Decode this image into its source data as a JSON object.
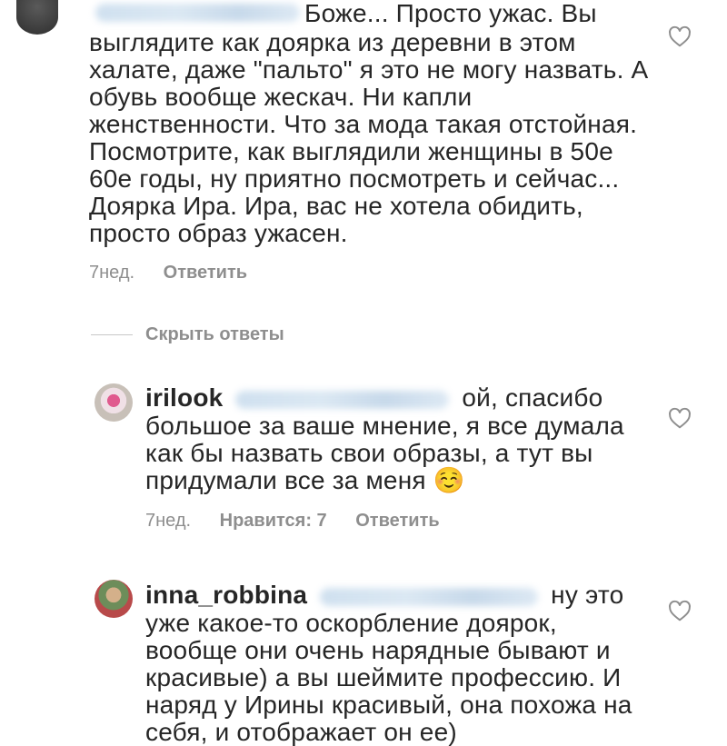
{
  "comment1": {
    "first_line": "Боже... Просто ужас. Вы",
    "lines": [
      "выглядите как доярка из деревни в этом",
      "халате, даже \"пальто\" я это не могу назвать. А",
      "обувь вообще жескач. Ни капли",
      "женственности. Что за мода такая отстойная.",
      "Посмотрите, как выглядили женщины в 50е",
      "60е годы, ну приятно посмотреть и сейчас...",
      "Доярка Ира. Ира, вас не хотела обидить,",
      "просто образ ужасен."
    ],
    "time": "7нед.",
    "reply_label": "Ответить",
    "like_icon": "heart-outline-icon"
  },
  "hide_replies_label": "Скрыть ответы",
  "reply1": {
    "username": "irilook",
    "first_line": "ой, спасибо",
    "lines": [
      "большое за ваше мнение, я все думала",
      "как бы назвать свои образы, а тут вы",
      "придумали все за меня ☺️"
    ],
    "time": "7нед.",
    "likes_label": "Нравится: 7",
    "reply_label": "Ответить",
    "like_icon": "heart-outline-icon"
  },
  "reply2": {
    "username": "inna_robbina",
    "first_line": "ну это",
    "lines": [
      "уже какое-то оскорбление доярок,",
      "вообще они очень нарядные бывают и",
      "красивые) а вы шеймите профессию. И",
      "наряд у Ирины красивый, она похожа на",
      "себя, и отображает он ее)"
    ],
    "like_icon": "heart-outline-icon"
  },
  "colors": {
    "text": "#262626",
    "meta": "#8e8e8e",
    "divider": "#c7c7c7"
  }
}
